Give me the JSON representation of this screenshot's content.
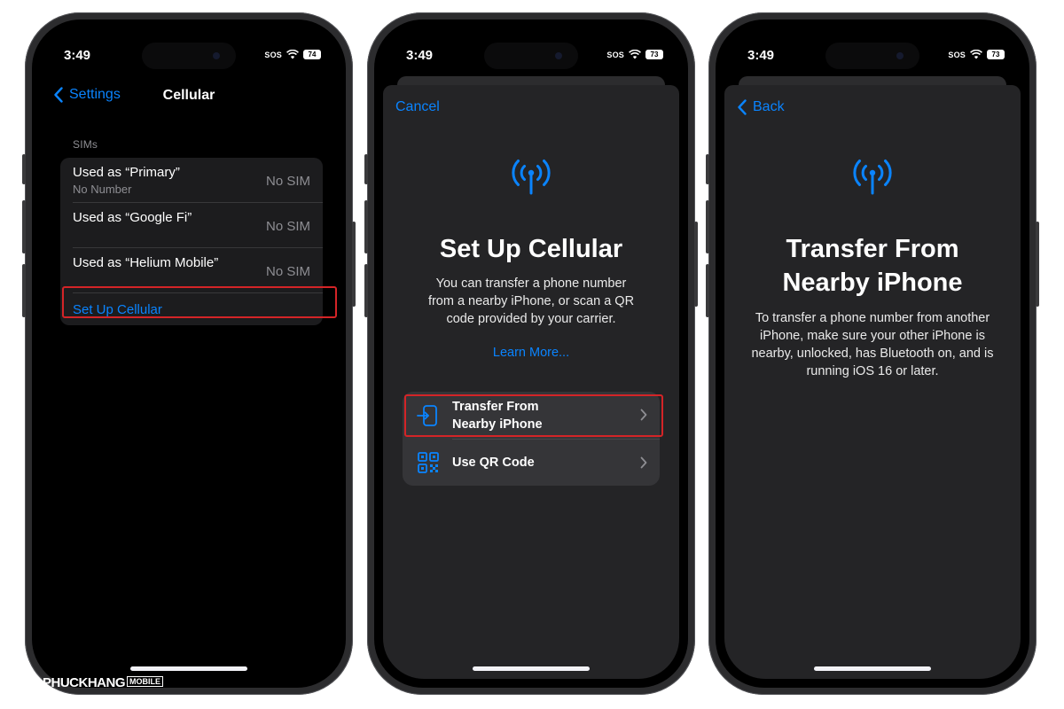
{
  "phones": [
    {
      "status": {
        "time": "3:49",
        "sos": "SOS",
        "battery": "74"
      },
      "nav": {
        "back": "Settings",
        "title": "Cellular"
      },
      "section_label": "SIMs",
      "sims": [
        {
          "title": "Used as “Primary”",
          "subtitle": "No Number",
          "value": "No SIM"
        },
        {
          "title": "Used as “Google Fi”",
          "subtitle": "",
          "value": "No SIM"
        },
        {
          "title": "Used as “Helium Mobile”",
          "subtitle": "",
          "value": "No SIM"
        }
      ],
      "action": "Set Up Cellular"
    },
    {
      "status": {
        "time": "3:49",
        "sos": "SOS",
        "battery": "73"
      },
      "cancel": "Cancel",
      "title": "Set Up Cellular",
      "body": "You can transfer a phone number from a nearby iPhone, or scan a QR code provided by your carrier.",
      "learn_more": "Learn More...",
      "options": [
        {
          "label": "Transfer From Nearby iPhone",
          "icon": "phone-transfer-icon"
        },
        {
          "label": "Use QR Code",
          "icon": "qr-code-icon"
        }
      ]
    },
    {
      "status": {
        "time": "3:49",
        "sos": "SOS",
        "battery": "73"
      },
      "back": "Back",
      "title": "Transfer From Nearby iPhone",
      "body": "To transfer a phone number from another iPhone, make sure your other iPhone is nearby, unlocked, has Bluetooth on, and is running iOS 16 or later."
    }
  ],
  "watermark": {
    "text": "PHUCKHANG",
    "tag": "MOBILE"
  },
  "colors": {
    "accent": "#0a84ff",
    "highlight": "#d42427",
    "sheet": "#242426"
  }
}
